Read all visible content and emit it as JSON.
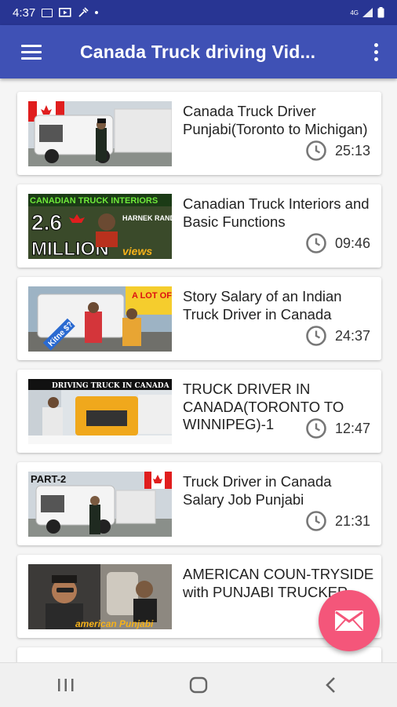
{
  "status_bar": {
    "time": "4:37",
    "network": "4G"
  },
  "toolbar": {
    "title": "Canada Truck driving Vid..."
  },
  "videos": [
    {
      "title": "Canada Truck Driver Punjabi(Toronto to Michigan)",
      "duration": "25:13"
    },
    {
      "title": "Canadian Truck Interiors and Basic Functions",
      "duration": "09:46"
    },
    {
      "title": "Story Salary of an Indian Truck Driver in Canada",
      "duration": "24:37"
    },
    {
      "title": "TRUCK DRIVER IN CANADA(TORONTO TO WINNIPEG)-1",
      "duration": "12:47"
    },
    {
      "title": "Truck Driver in Canada Salary Job Punjabi",
      "duration": "21:31"
    },
    {
      "title": "AMERICAN COUN-TRYSIDE with PUNJABI TRUCKER",
      "duration": ""
    }
  ],
  "thumbnails": {
    "t2_top": "CANADIAN TRUCK INTERIORS",
    "t2_big": "2.6",
    "t2_million": "MILLION",
    "t2_views": "views",
    "t2_name": "HARNEK RANDHAWA",
    "t3_badge": "A LOT OF $$$",
    "t3_sign": "Kitne $?",
    "t4_banner": "DRIVING TRUCK IN CANADA",
    "t5_part": "PART-2",
    "t6_tag": "american Punjabi"
  },
  "colors": {
    "status_bar": "#283593",
    "toolbar": "#3f51b5",
    "fab": "#f4567a"
  },
  "icons": [
    "menu-icon",
    "more-vert-icon",
    "clock-icon",
    "mail-icon",
    "recents-icon",
    "home-icon",
    "back-icon"
  ]
}
